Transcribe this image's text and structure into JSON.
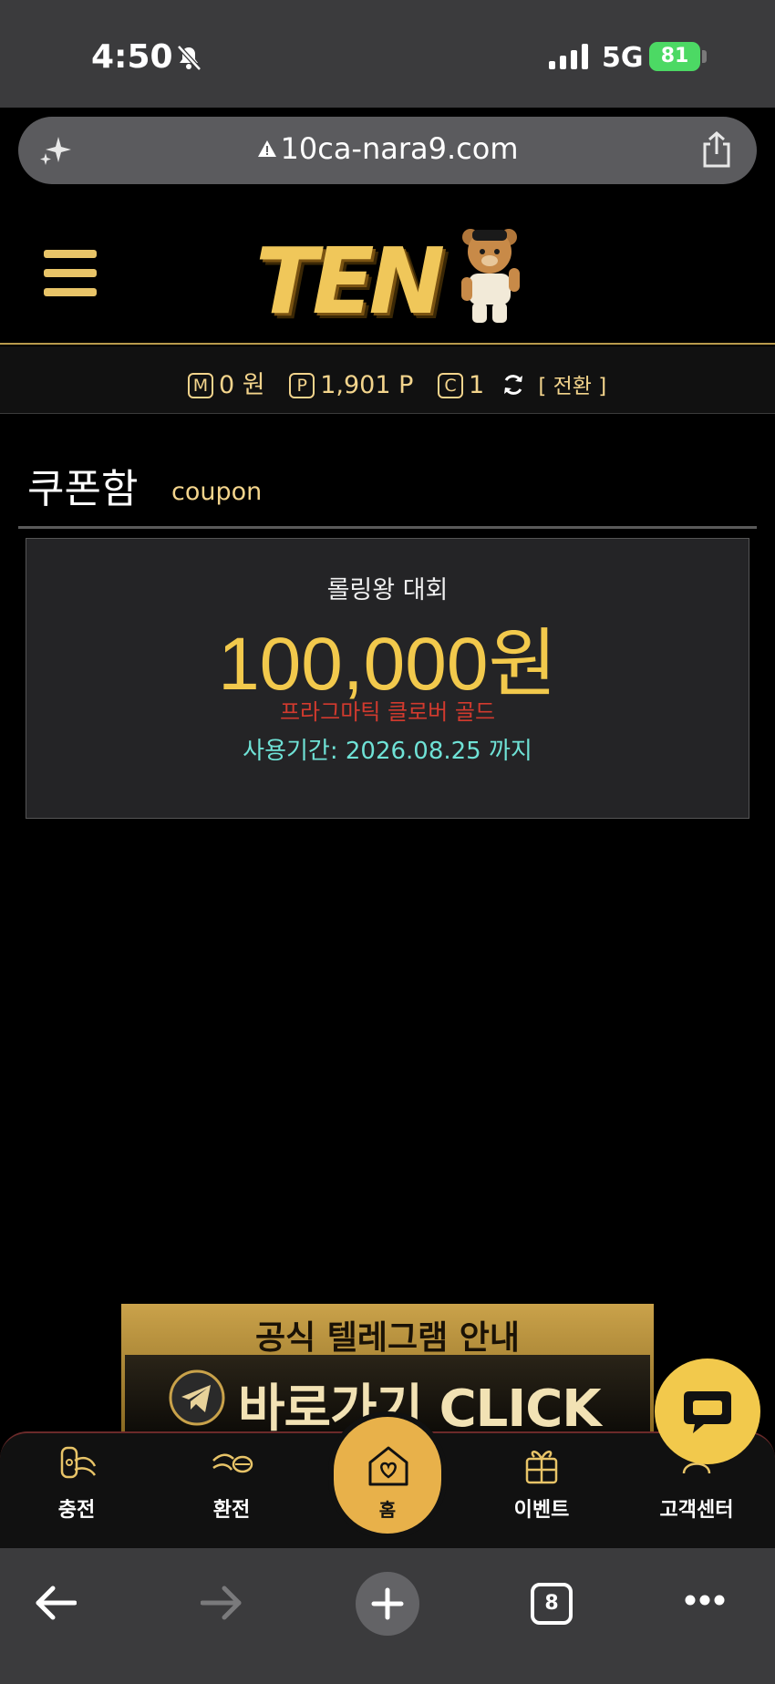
{
  "status_bar": {
    "time": "4:50",
    "network": "5G",
    "battery": "81"
  },
  "browser": {
    "url": "10ca-nara9.com",
    "tab_count": "8"
  },
  "header": {
    "logo_text": "TEN"
  },
  "points": {
    "money_badge": "M",
    "money": "0 원",
    "point_badge": "P",
    "point": "1,901 P",
    "coupon_badge": "C",
    "coupon": "1",
    "switch_label": "[ 전환 ]"
  },
  "page": {
    "title": "쿠폰함",
    "subtitle": "coupon"
  },
  "coupon": {
    "name": "롤링왕 대회",
    "amount": "100,000원",
    "game": "프라그마틱 클로버 골드",
    "expiry": "사용기간: 2026.08.25 까지"
  },
  "banner": {
    "title": "공식 텔레그램 안내",
    "cta": "바로가기 CLICK"
  },
  "bottom_nav": {
    "charge": "충전",
    "exchange": "환전",
    "home": "홈",
    "event": "이벤트",
    "support": "고객센터"
  },
  "colors": {
    "gold": "#f2c94c",
    "expiry": "#6fe2d6",
    "game": "#d23a2e",
    "background": "#000000"
  }
}
